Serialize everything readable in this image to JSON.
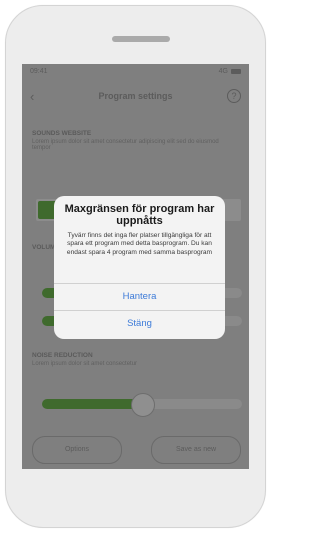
{
  "status_bar": {
    "time": "09:41",
    "right": "4G"
  },
  "header": {
    "title": "Program settings",
    "back_icon": "chevron-left-icon",
    "help_icon": "question-icon"
  },
  "content": {
    "section1_label": "SOUNDS WEBSITE",
    "section1_desc": "Lorem ipsum dolor sit amet consectetur adipiscing elit sed do eiusmod tempor",
    "section2_label": "VOLUME",
    "section3_label": "NOISE REDUCTION",
    "section3_desc": "Lorem ipsum dolor sit amet consectetur",
    "slider_levels": {
      "first": 0.55,
      "second": 0.45,
      "third": 0.5
    },
    "bottom_left": "Options",
    "bottom_right": "Save as new"
  },
  "dialog": {
    "title": "Maxgränsen för program har uppnåtts",
    "message": "Tyvärr finns det inga fler platser tillgängliga för att spara ett program med detta basprogram. Du kan endast spara 4 program med samma basprogram",
    "primary_button": "Hantera",
    "secondary_button": "Stäng"
  },
  "colors": {
    "accent": "#3d7bd8",
    "overlay": "#7f7f7f",
    "active_segment": "#3f6a2d"
  }
}
